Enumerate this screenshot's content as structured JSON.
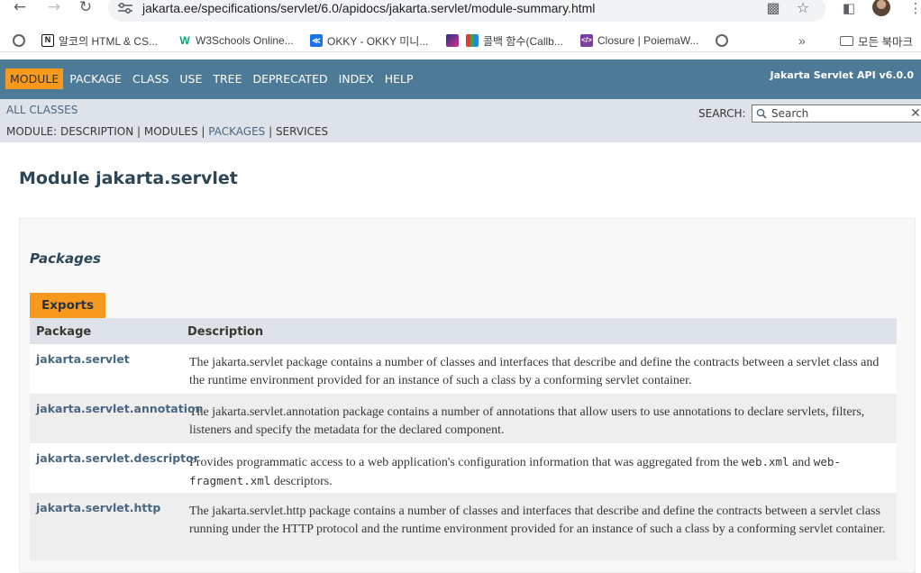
{
  "browser": {
    "url": "jakarta.ee/specifications/servlet/6.0/apidocs/jakarta.servlet/module-summary.html",
    "bookmarks": [
      {
        "label": "",
        "icon": "globe-icon"
      },
      {
        "label": "알코의 HTML & CS...",
        "icon": "notion-icon"
      },
      {
        "label": "W3Schools Online...",
        "icon": "w3schools-icon"
      },
      {
        "label": "OKKY - OKKY 미니...",
        "icon": "okky-icon"
      },
      {
        "label": "",
        "icon": "paint-icon"
      },
      {
        "label": "콜백 함수(Callb...",
        "icon": "poiema-icon"
      },
      {
        "label": "Closure | PoiemaW...",
        "icon": "code-icon"
      },
      {
        "label": "",
        "icon": "globe-icon"
      }
    ],
    "bookmarks_folder": "모든 북마크"
  },
  "nav": {
    "items": [
      "Module",
      "Package",
      "Class",
      "Use",
      "Tree",
      "Deprecated",
      "Index",
      "Help"
    ],
    "about": "Jakarta Servlet API v6.0.0"
  },
  "subnav": {
    "all_classes": "All Classes",
    "module_prefix": "Module:",
    "links": [
      "Description",
      "Modules",
      "Packages",
      "Services"
    ],
    "search_label": "SEARCH:",
    "search_placeholder": "Search"
  },
  "page": {
    "title": "Module jakarta.servlet",
    "section": "Packages",
    "caption": "Exports",
    "columns": [
      "Package",
      "Description"
    ],
    "rows": [
      {
        "package": "jakarta.servlet",
        "description": [
          "The jakarta.servlet package contains a number of classes and interfaces that describe and define the contracts between a servlet class and the runtime environment provided for an instance of such a class by a conforming servlet container."
        ]
      },
      {
        "package": "jakarta.servlet.annotation",
        "description": [
          "The jakarta.servlet.annotation package contains a number of annotations that allow users to use annotations to declare servlets, filters, listeners and specify the metadata for the declared component."
        ]
      },
      {
        "package": "jakarta.servlet.descriptor",
        "description": [
          "Provides programmatic access to a web application's configuration information that was aggregated from the ",
          "web.xml",
          " and ",
          "web-fragment.xml",
          " descriptors."
        ]
      },
      {
        "package": "jakarta.servlet.http",
        "description": [
          "The jakarta.servlet.http package contains a number of classes and interfaces that describe and define the contracts between a servlet class running under the HTTP protocol and the runtime environment provided for an instance of such a class by a conforming servlet container."
        ]
      }
    ]
  },
  "colors": {
    "nav_bg": "#4d7a97",
    "accent": "#f8981d",
    "subnav_bg": "#dee3e9",
    "link": "#4a6782"
  }
}
